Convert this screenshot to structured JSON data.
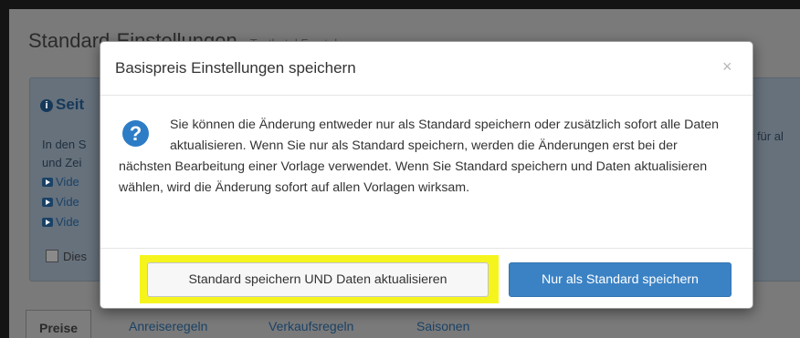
{
  "background": {
    "title": "Standard-Einstellungen",
    "subtitle": "Testhotel Forstel",
    "info_heading": "Seit",
    "info_lines": [
      "In den S",
      "und Zei"
    ],
    "info_right_fragment": "r für al",
    "video_links": [
      "Vide",
      "Vide",
      "Vide"
    ],
    "checkbox_label": "Dies",
    "tabs": [
      "Preise",
      "Anreiseregeln",
      "Verkaufsregeln",
      "Saisonen"
    ],
    "active_tab": "Preise"
  },
  "modal": {
    "title": "Basispreis Einstellungen speichern",
    "close_symbol": "×",
    "icon": "question-circle-icon",
    "icon_glyph": "?",
    "message": "Sie können die Änderung entweder nur als Standard speichern oder zusätzlich sofort alle Daten aktualisieren. Wenn Sie nur als Standard speichern, werden die Änderungen erst bei der nächsten Bearbeitung einer Vorlage verwendet. Wenn Sie Standard speichern und Daten aktualisieren wählen, wird die Änderung sofort auf allen Vorlagen wirksam.",
    "buttons": {
      "save_and_update": "Standard speichern UND Daten aktualisieren",
      "save_default_only": "Nur als Standard speichern"
    },
    "highlight_color": "#f5f51d",
    "primary_color": "#3b82c4"
  }
}
